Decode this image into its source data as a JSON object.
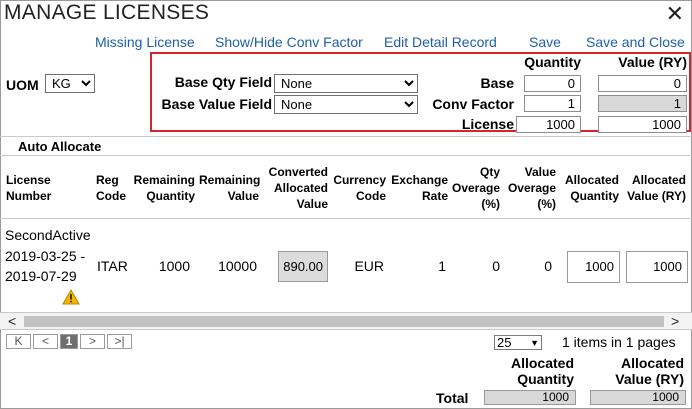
{
  "window": {
    "title": "MANAGE LICENSES",
    "close_glyph": "✕"
  },
  "toolbar": {
    "missing_license": "Missing License",
    "show_hide_conv": "Show/Hide Conv Factor",
    "edit_detail": "Edit Detail Record",
    "save": "Save",
    "save_close": "Save and Close"
  },
  "uom": {
    "label": "UOM",
    "value": "KG"
  },
  "fields": {
    "base_qty_label": "Base Qty Field",
    "base_qty_value": "None",
    "base_value_label": "Base Value Field",
    "base_value_value": "None"
  },
  "conversion": {
    "quantity_header": "Quantity",
    "value_header": "Value (RY)",
    "rows": [
      {
        "label": "Base",
        "quantity": "0",
        "value": "0"
      },
      {
        "label": "Conv Factor",
        "quantity": "1",
        "value": "1"
      },
      {
        "label": "License",
        "quantity": "1000",
        "value": "1000"
      }
    ]
  },
  "auto_allocate": "Auto Allocate",
  "grid": {
    "headers": [
      "License Number",
      "Reg Code",
      "Remaining Quantity",
      "Remaining Value",
      "Converted Allocated Value",
      "Currency Code",
      "Exchange Rate",
      "Qty Overage (%)",
      "Value Overage (%)",
      "Allocated Quantity",
      "Allocated Value (RY)"
    ],
    "row": {
      "license_line1": "SecondActive",
      "license_line2": "2019-03-25 -",
      "license_line3": "2019-07-29",
      "reg_code": "ITAR",
      "remaining_quantity": "1000",
      "remaining_value": "10000",
      "converted_allocated_value": "890.00",
      "currency_code": "EUR",
      "exchange_rate": "1",
      "qty_overage": "0",
      "value_overage": "0",
      "allocated_quantity": "1000",
      "allocated_value": "1000"
    }
  },
  "pager": {
    "first": "K",
    "prev": "<",
    "current_page": "1",
    "next": ">",
    "last": ">|",
    "page_size": "25",
    "summary": "1 items in 1 pages"
  },
  "totals": {
    "alloc_qty_line1": "Allocated",
    "alloc_qty_line2": "Quantity",
    "alloc_val_line1": "Allocated",
    "alloc_val_line2": "Value (RY)",
    "label": "Total",
    "quantity": "1000",
    "value": "1000"
  },
  "colors": {
    "link": "#1f5fa8",
    "highlight_border": "#d6252d",
    "warning": "#f2b600"
  }
}
